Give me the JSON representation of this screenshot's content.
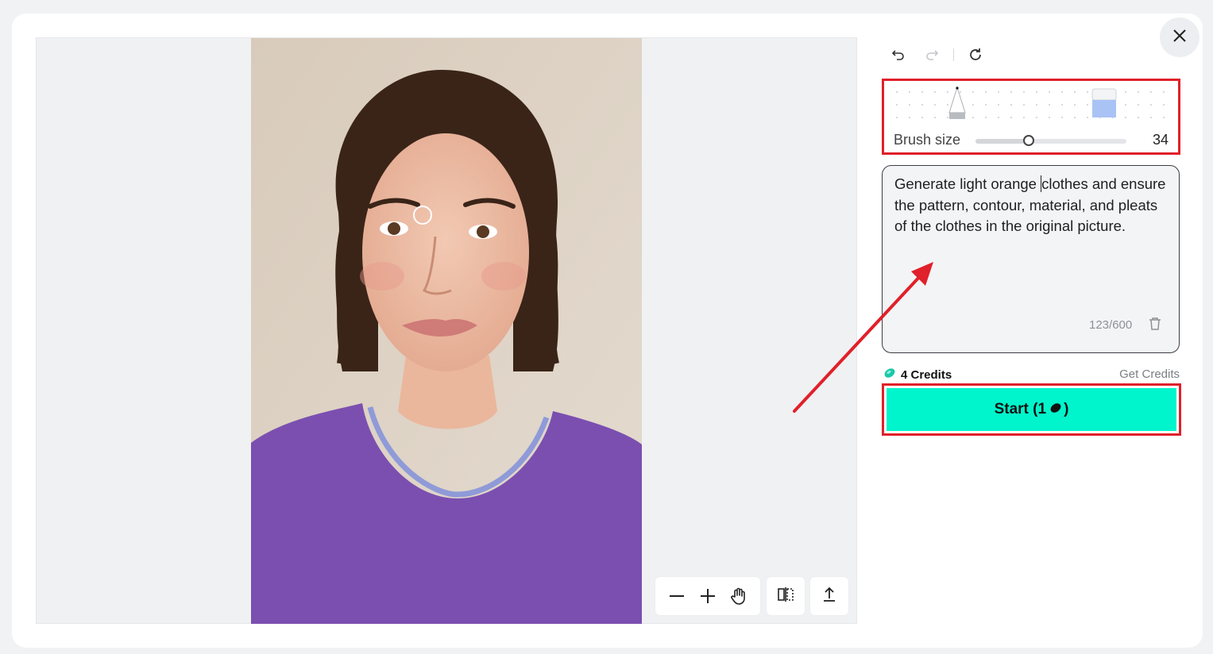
{
  "toolbar": {
    "undo_icon": "undo-icon",
    "redo_icon": "redo-icon",
    "refresh_icon": "refresh-icon",
    "close_icon": "close-icon"
  },
  "brush": {
    "label": "Brush size",
    "value": "34",
    "level": 0.35,
    "tools": [
      "pen-icon",
      "eraser-icon"
    ]
  },
  "prompt": {
    "text_before_cursor": "Generate light orange ",
    "text_after_cursor": "clothes and ensure the pattern, contour, material, and pleats of the clothes in the original picture.",
    "counter": "123/600"
  },
  "credits": {
    "amount_label": "4 Credits",
    "get_label": "Get Credits"
  },
  "start": {
    "label_prefix": "Start (1",
    "label_suffix": ")"
  },
  "canvas_tools": [
    "zoom-out-icon",
    "zoom-in-icon",
    "hand-icon",
    "compare-icon",
    "export-icon"
  ],
  "colors": {
    "start_button": "#00f5cc",
    "highlight": "#e0202a",
    "mask": "#7b4fb0"
  }
}
